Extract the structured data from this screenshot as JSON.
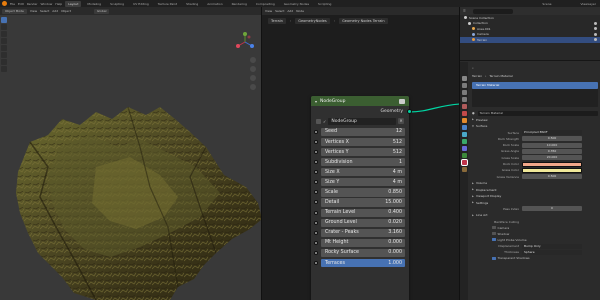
{
  "menubar": {
    "menus": [
      "File",
      "Edit",
      "Render",
      "Window",
      "Help"
    ],
    "workspaces": [
      "Layout",
      "Modeling",
      "Sculpting",
      "UV Editing",
      "Texture Paint",
      "Shading",
      "Animation",
      "Rendering",
      "Compositing",
      "Geometry Nodes",
      "Scripting"
    ],
    "active_workspace": "Layout",
    "scene": "Scene",
    "view_layer": "ViewLayer"
  },
  "viewport": {
    "mode": "Object Mode",
    "menus": [
      "View",
      "Select",
      "Add",
      "Object"
    ],
    "shading": "Global"
  },
  "node_editor": {
    "menus": [
      "View",
      "Select",
      "Add",
      "Node"
    ],
    "breadcrumb": [
      "Terrain",
      "GeometryNodes",
      "Geometry Nodes Terrain"
    ],
    "node": {
      "title": "NodeGroup",
      "output_label": "Geometry",
      "group_name": "NodeGroup",
      "params": [
        {
          "label": "Seed",
          "value": "12"
        },
        {
          "label": "Vertices X",
          "value": "512"
        },
        {
          "label": "Vertices Y",
          "value": "512"
        },
        {
          "label": "Subdivision",
          "value": "1"
        },
        {
          "label": "Size X",
          "value": "4 m"
        },
        {
          "label": "Size Y",
          "value": "4 m"
        },
        {
          "label": "Scale",
          "value": "0.850"
        },
        {
          "label": "Detail",
          "value": "15.000"
        },
        {
          "label": "Terrain Level",
          "value": "0.400"
        },
        {
          "label": "Ground Level",
          "value": "0.020"
        },
        {
          "label": "Crater - Peaks",
          "value": "3.160"
        },
        {
          "label": "Mt Height",
          "value": "0.000"
        },
        {
          "label": "Rocky Surface",
          "value": "0.000"
        },
        {
          "label": "Terraces",
          "value": "1.000"
        }
      ]
    }
  },
  "outliner": {
    "title": "Scene Collection",
    "rows": [
      {
        "label": "Scene Collection",
        "selected": false,
        "color": "#cccccc"
      },
      {
        "label": "Collection",
        "selected": false,
        "color": "#cccccc"
      },
      {
        "label": "Area.001",
        "selected": false,
        "color": "#e5a64b"
      },
      {
        "label": "Camera",
        "selected": false,
        "color": "#8aa6d8"
      },
      {
        "label": "Terrain",
        "selected": true,
        "color": "#e59a3c"
      }
    ]
  },
  "properties": {
    "crumbs": [
      "Terrain",
      "Terrain Material"
    ],
    "slot": "Terrain Material",
    "material_name": "Terrain Material",
    "sections": {
      "preview": "Preview",
      "surface": "Surface"
    },
    "surface_rows": [
      {
        "label": "Surface",
        "value": "Principled BSDF",
        "kind": "dark"
      },
      {
        "label": "Rock Strength",
        "value": "0.500",
        "kind": "num"
      },
      {
        "label": "Rock Scale",
        "value": "10.000",
        "kind": "num"
      },
      {
        "label": "Grass Angle",
        "value": "0.350",
        "kind": "num"
      },
      {
        "label": "Grass Scale",
        "value": "20.000",
        "kind": "num"
      },
      {
        "label": "Rock Color",
        "value": "",
        "kind": "swatch",
        "color": "#f2a88a"
      },
      {
        "label": "Grass Color",
        "value": "",
        "kind": "swatch",
        "color": "#f0e89a"
      },
      {
        "label": "Grass Variance",
        "value": "0.500",
        "kind": "num"
      }
    ],
    "more_sections": [
      "Volume",
      "Displacement",
      "Viewport Display",
      "Settings"
    ],
    "pass_index": {
      "label": "Pass Index",
      "value": "0"
    },
    "lineart": "Line Art",
    "backface": {
      "label": "Backface Culling",
      "checks": [
        {
          "label": "Camera",
          "checked": false
        },
        {
          "label": "Shadow",
          "checked": false
        },
        {
          "label": "Light Probe Volume",
          "checked": true
        }
      ]
    },
    "displacement": {
      "label": "Displacement",
      "value": "Bump Only"
    },
    "thickness": {
      "label": "Thickness",
      "value": "Sphere"
    },
    "transparent": {
      "label": "Transparent Shadows",
      "checked": true
    }
  },
  "colors": {
    "node_header": "#3b5e31",
    "link": "#00d6a3",
    "highlight": "#4772b3"
  }
}
